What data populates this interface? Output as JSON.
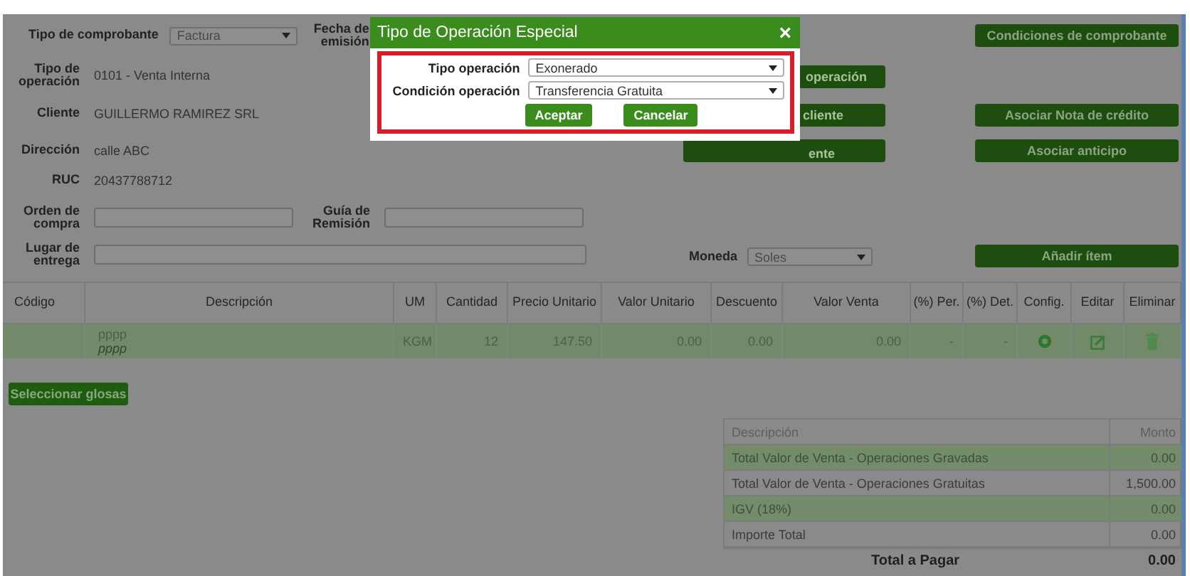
{
  "tipo_comprobante": {
    "label": "Tipo de comprobante",
    "value": "Factura"
  },
  "fecha_emision": {
    "label": "Fecha de emisión"
  },
  "info_rows": [
    {
      "label": "Tipo de operación",
      "value": "0101 - Venta Interna"
    },
    {
      "label": "Cliente",
      "value": "GUILLERMO RAMIREZ SRL"
    },
    {
      "label": "Dirección",
      "value": "calle ABC"
    },
    {
      "label": "RUC",
      "value": "20437788712"
    }
  ],
  "orden_compra": {
    "label": "Orden de compra"
  },
  "guia_remision": {
    "label": "Guía de Remisión"
  },
  "lugar_entrega": {
    "label": "Lugar de entrega"
  },
  "moneda": {
    "label": "Moneda",
    "value": "Soles"
  },
  "middle_buttons": [
    "operación",
    "cliente",
    "ente"
  ],
  "right_buttons": [
    "Condiciones de comprobante",
    "Asociar Nota de crédito",
    "Asociar anticipo"
  ],
  "add_item_button": "Añadir ítem",
  "table": {
    "columns": [
      "Código",
      "Descripción",
      "UM",
      "Cantidad",
      "Precio Unitario",
      "Valor Unitario",
      "Descuento",
      "Valor Venta",
      "(%) Per.",
      "(%) Det.",
      "Config.",
      "Editar",
      "Eliminar"
    ],
    "rows": [
      {
        "selected": true,
        "descripcion": "pppp",
        "detalle": "pppp",
        "um": "KGM",
        "cantidad": "12",
        "precio_unitario": "147.50",
        "valor_unitario": "0.00",
        "descuento": "0.00",
        "valor_venta": "0.00",
        "per": "-",
        "det": "-"
      }
    ]
  },
  "glosas_button": "Seleccionar glosas",
  "summary": {
    "columns": [
      "Descripción",
      "Monto"
    ],
    "rows": [
      {
        "descripcion": "Total Valor de Venta - Operaciones Gravadas",
        "monto": "0.00"
      },
      {
        "descripcion": "Total Valor de Venta - Operaciones Gratuitas",
        "monto": "1,500.00"
      },
      {
        "descripcion": "IGV (18%)",
        "monto": "0.00"
      },
      {
        "descripcion": "Importe Total",
        "monto": "0.00"
      }
    ]
  },
  "total": {
    "label": "Total a Pagar",
    "value": "0.00"
  },
  "dialog": {
    "title": "Tipo de Operación Especial",
    "close": "×",
    "fields": [
      {
        "label": "Tipo operación",
        "value": "Exonerado"
      },
      {
        "label": "Condición operación",
        "value": "Transferencia Gratuita"
      }
    ],
    "buttons": [
      "Aceptar",
      "Cancelar"
    ]
  }
}
